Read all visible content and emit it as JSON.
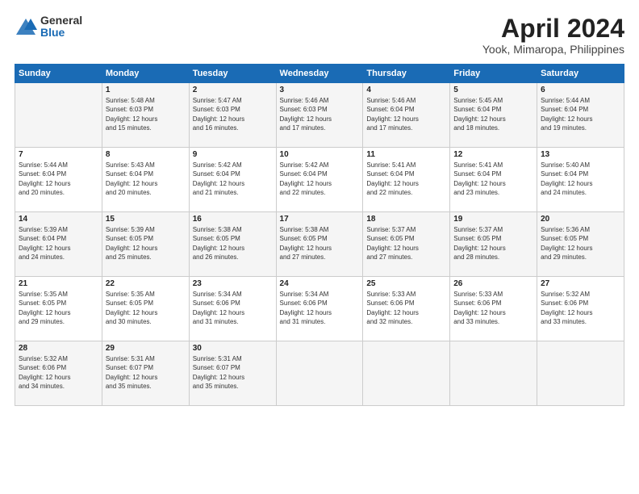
{
  "header": {
    "logo_general": "General",
    "logo_blue": "Blue",
    "title": "April 2024",
    "subtitle": "Yook, Mimaropa, Philippines"
  },
  "days_of_week": [
    "Sunday",
    "Monday",
    "Tuesday",
    "Wednesday",
    "Thursday",
    "Friday",
    "Saturday"
  ],
  "weeks": [
    [
      {
        "day": "",
        "info": ""
      },
      {
        "day": "1",
        "info": "Sunrise: 5:48 AM\nSunset: 6:03 PM\nDaylight: 12 hours\nand 15 minutes."
      },
      {
        "day": "2",
        "info": "Sunrise: 5:47 AM\nSunset: 6:03 PM\nDaylight: 12 hours\nand 16 minutes."
      },
      {
        "day": "3",
        "info": "Sunrise: 5:46 AM\nSunset: 6:03 PM\nDaylight: 12 hours\nand 17 minutes."
      },
      {
        "day": "4",
        "info": "Sunrise: 5:46 AM\nSunset: 6:04 PM\nDaylight: 12 hours\nand 17 minutes."
      },
      {
        "day": "5",
        "info": "Sunrise: 5:45 AM\nSunset: 6:04 PM\nDaylight: 12 hours\nand 18 minutes."
      },
      {
        "day": "6",
        "info": "Sunrise: 5:44 AM\nSunset: 6:04 PM\nDaylight: 12 hours\nand 19 minutes."
      }
    ],
    [
      {
        "day": "7",
        "info": "Sunrise: 5:44 AM\nSunset: 6:04 PM\nDaylight: 12 hours\nand 20 minutes."
      },
      {
        "day": "8",
        "info": "Sunrise: 5:43 AM\nSunset: 6:04 PM\nDaylight: 12 hours\nand 20 minutes."
      },
      {
        "day": "9",
        "info": "Sunrise: 5:42 AM\nSunset: 6:04 PM\nDaylight: 12 hours\nand 21 minutes."
      },
      {
        "day": "10",
        "info": "Sunrise: 5:42 AM\nSunset: 6:04 PM\nDaylight: 12 hours\nand 22 minutes."
      },
      {
        "day": "11",
        "info": "Sunrise: 5:41 AM\nSunset: 6:04 PM\nDaylight: 12 hours\nand 22 minutes."
      },
      {
        "day": "12",
        "info": "Sunrise: 5:41 AM\nSunset: 6:04 PM\nDaylight: 12 hours\nand 23 minutes."
      },
      {
        "day": "13",
        "info": "Sunrise: 5:40 AM\nSunset: 6:04 PM\nDaylight: 12 hours\nand 24 minutes."
      }
    ],
    [
      {
        "day": "14",
        "info": "Sunrise: 5:39 AM\nSunset: 6:04 PM\nDaylight: 12 hours\nand 24 minutes."
      },
      {
        "day": "15",
        "info": "Sunrise: 5:39 AM\nSunset: 6:05 PM\nDaylight: 12 hours\nand 25 minutes."
      },
      {
        "day": "16",
        "info": "Sunrise: 5:38 AM\nSunset: 6:05 PM\nDaylight: 12 hours\nand 26 minutes."
      },
      {
        "day": "17",
        "info": "Sunrise: 5:38 AM\nSunset: 6:05 PM\nDaylight: 12 hours\nand 27 minutes."
      },
      {
        "day": "18",
        "info": "Sunrise: 5:37 AM\nSunset: 6:05 PM\nDaylight: 12 hours\nand 27 minutes."
      },
      {
        "day": "19",
        "info": "Sunrise: 5:37 AM\nSunset: 6:05 PM\nDaylight: 12 hours\nand 28 minutes."
      },
      {
        "day": "20",
        "info": "Sunrise: 5:36 AM\nSunset: 6:05 PM\nDaylight: 12 hours\nand 29 minutes."
      }
    ],
    [
      {
        "day": "21",
        "info": "Sunrise: 5:35 AM\nSunset: 6:05 PM\nDaylight: 12 hours\nand 29 minutes."
      },
      {
        "day": "22",
        "info": "Sunrise: 5:35 AM\nSunset: 6:05 PM\nDaylight: 12 hours\nand 30 minutes."
      },
      {
        "day": "23",
        "info": "Sunrise: 5:34 AM\nSunset: 6:06 PM\nDaylight: 12 hours\nand 31 minutes."
      },
      {
        "day": "24",
        "info": "Sunrise: 5:34 AM\nSunset: 6:06 PM\nDaylight: 12 hours\nand 31 minutes."
      },
      {
        "day": "25",
        "info": "Sunrise: 5:33 AM\nSunset: 6:06 PM\nDaylight: 12 hours\nand 32 minutes."
      },
      {
        "day": "26",
        "info": "Sunrise: 5:33 AM\nSunset: 6:06 PM\nDaylight: 12 hours\nand 33 minutes."
      },
      {
        "day": "27",
        "info": "Sunrise: 5:32 AM\nSunset: 6:06 PM\nDaylight: 12 hours\nand 33 minutes."
      }
    ],
    [
      {
        "day": "28",
        "info": "Sunrise: 5:32 AM\nSunset: 6:06 PM\nDaylight: 12 hours\nand 34 minutes."
      },
      {
        "day": "29",
        "info": "Sunrise: 5:31 AM\nSunset: 6:07 PM\nDaylight: 12 hours\nand 35 minutes."
      },
      {
        "day": "30",
        "info": "Sunrise: 5:31 AM\nSunset: 6:07 PM\nDaylight: 12 hours\nand 35 minutes."
      },
      {
        "day": "",
        "info": ""
      },
      {
        "day": "",
        "info": ""
      },
      {
        "day": "",
        "info": ""
      },
      {
        "day": "",
        "info": ""
      }
    ]
  ]
}
